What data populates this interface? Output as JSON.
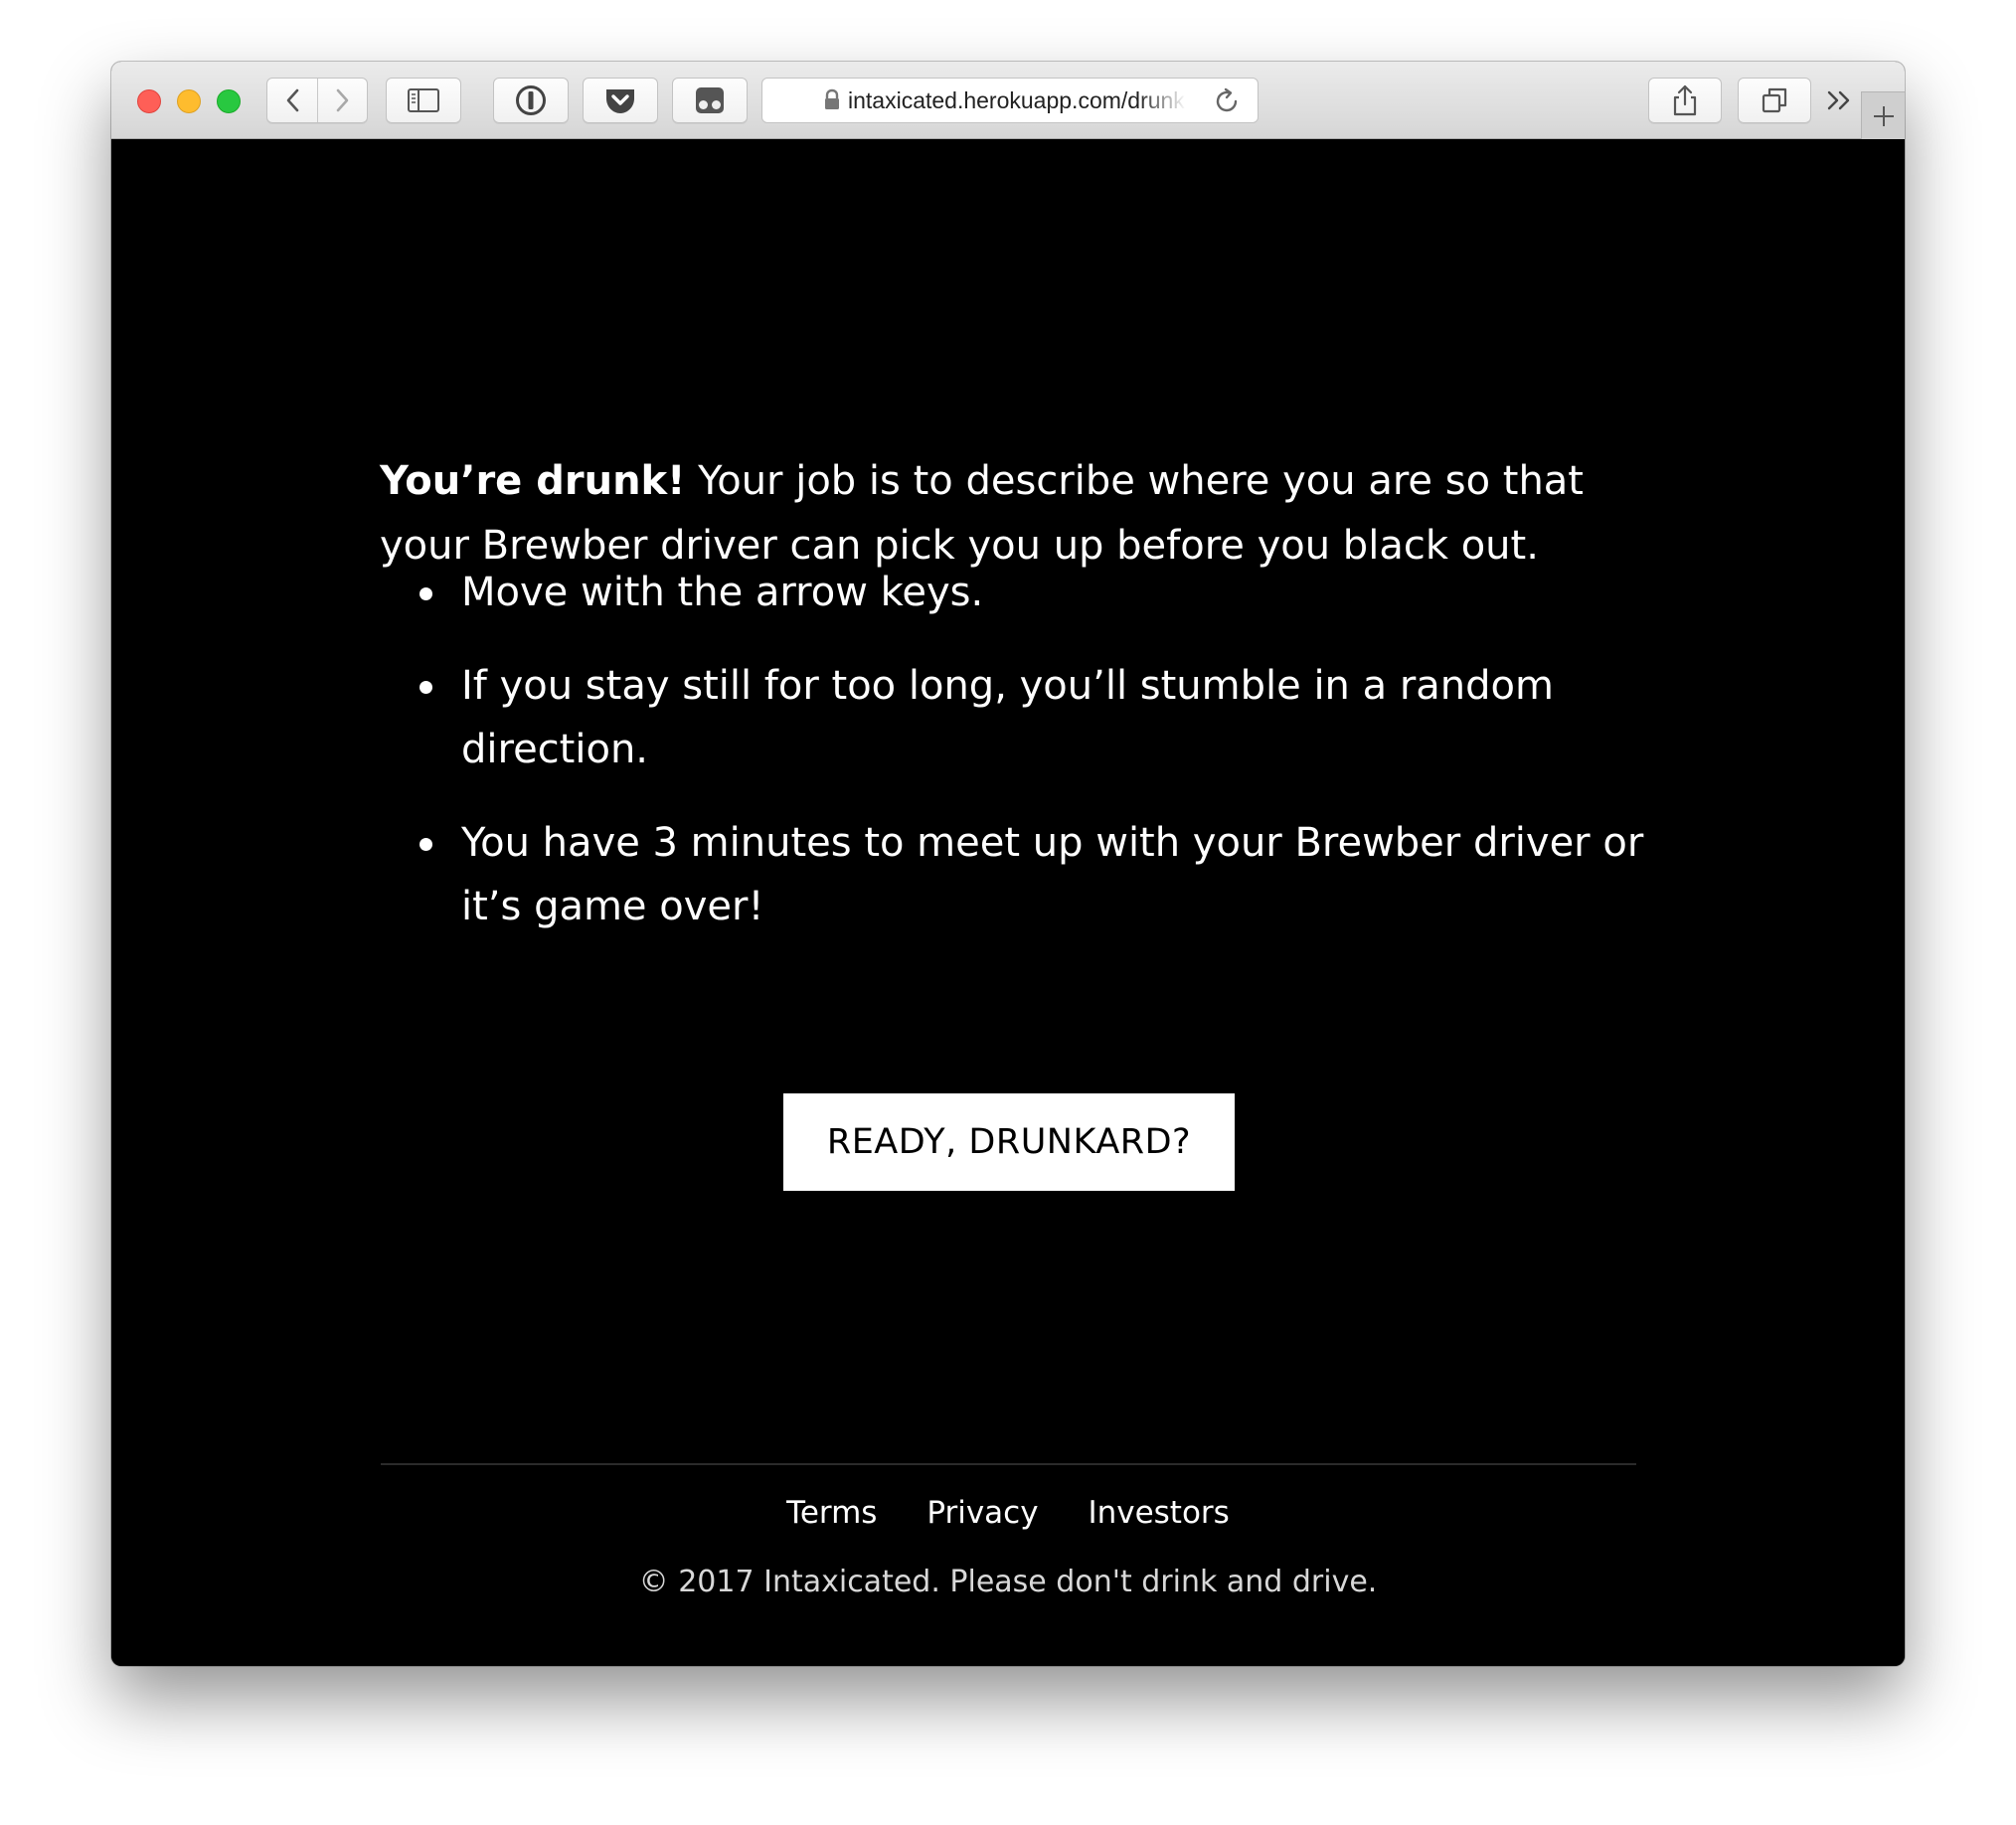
{
  "browser": {
    "url": "intaxicated.herokuapp.com/drunk",
    "icons": {
      "back": "chevron-left-icon",
      "forward": "chevron-right-icon",
      "sidebar": "sidebar-icon",
      "password_manager": "1password-icon",
      "pocket": "pocket-icon",
      "ghostery": "ghost-icon",
      "lock": "lock-icon",
      "reload": "reload-icon",
      "share": "share-icon",
      "tabs": "tab-overview-icon",
      "more": "double-chevron-right-icon",
      "new_tab": "plus-icon"
    }
  },
  "page": {
    "intro_bold": "You’re drunk!",
    "intro_rest": " Your job is to describe where you are so that your Brewber driver can pick you up before you black out.",
    "rules": [
      "Move with the arrow keys.",
      "If you stay still for too long, you’ll stumble in a random direction.",
      "You have 3 minutes to meet up with your Brewber driver or it’s game over!"
    ],
    "ready_button": "READY, DRUNKARD?"
  },
  "footer": {
    "links": {
      "terms": "Terms",
      "privacy": "Privacy",
      "investors": "Investors"
    },
    "copyright": "© 2017 Intaxicated. Please don't drink and drive."
  },
  "colors": {
    "page_background": "#000000",
    "text": "#ffffff",
    "button_background": "#ffffff",
    "button_text": "#000000",
    "close": "#fe5f57",
    "minimize": "#febc2e",
    "maximize": "#28c840"
  }
}
